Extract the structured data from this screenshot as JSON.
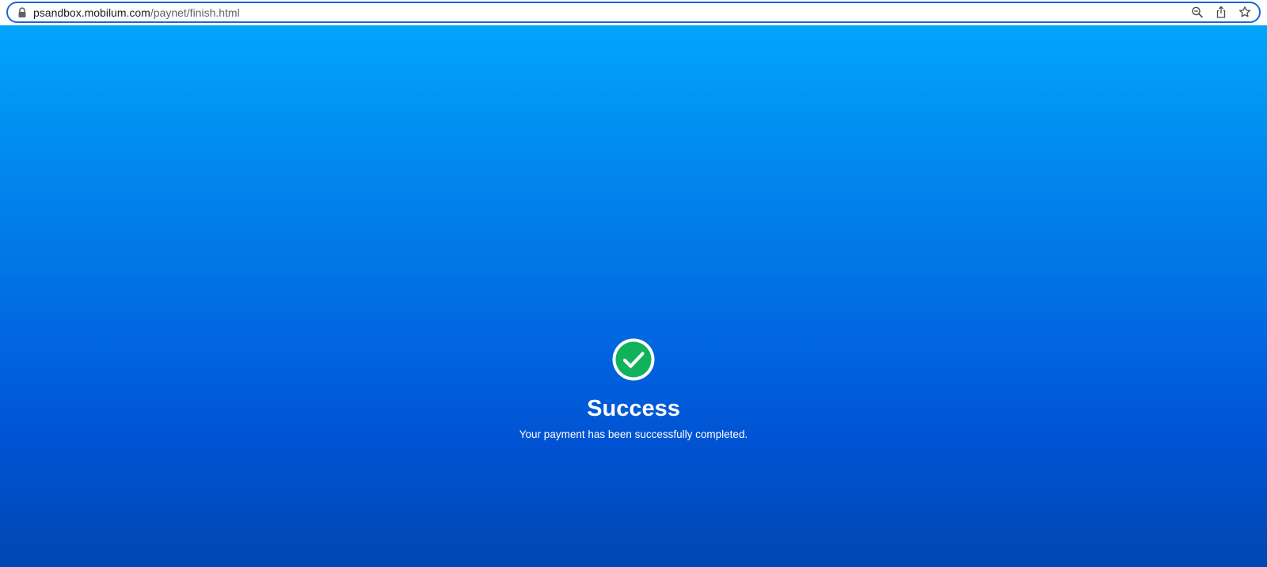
{
  "browser": {
    "url_host": "psandbox.mobilum.com",
    "url_path": "/paynet/finish.html",
    "icons": [
      "lock-icon",
      "zoom-icon",
      "share-icon",
      "bookmark-star-icon"
    ]
  },
  "status": {
    "icon": "check-circle-icon",
    "icon_color": "#12b15b",
    "title": "Success",
    "message": "Your payment has been successfully completed."
  },
  "colors": {
    "background_top": "#02a5fb",
    "background_bottom": "#0047b2",
    "url_field_border": "#1a66d6"
  }
}
